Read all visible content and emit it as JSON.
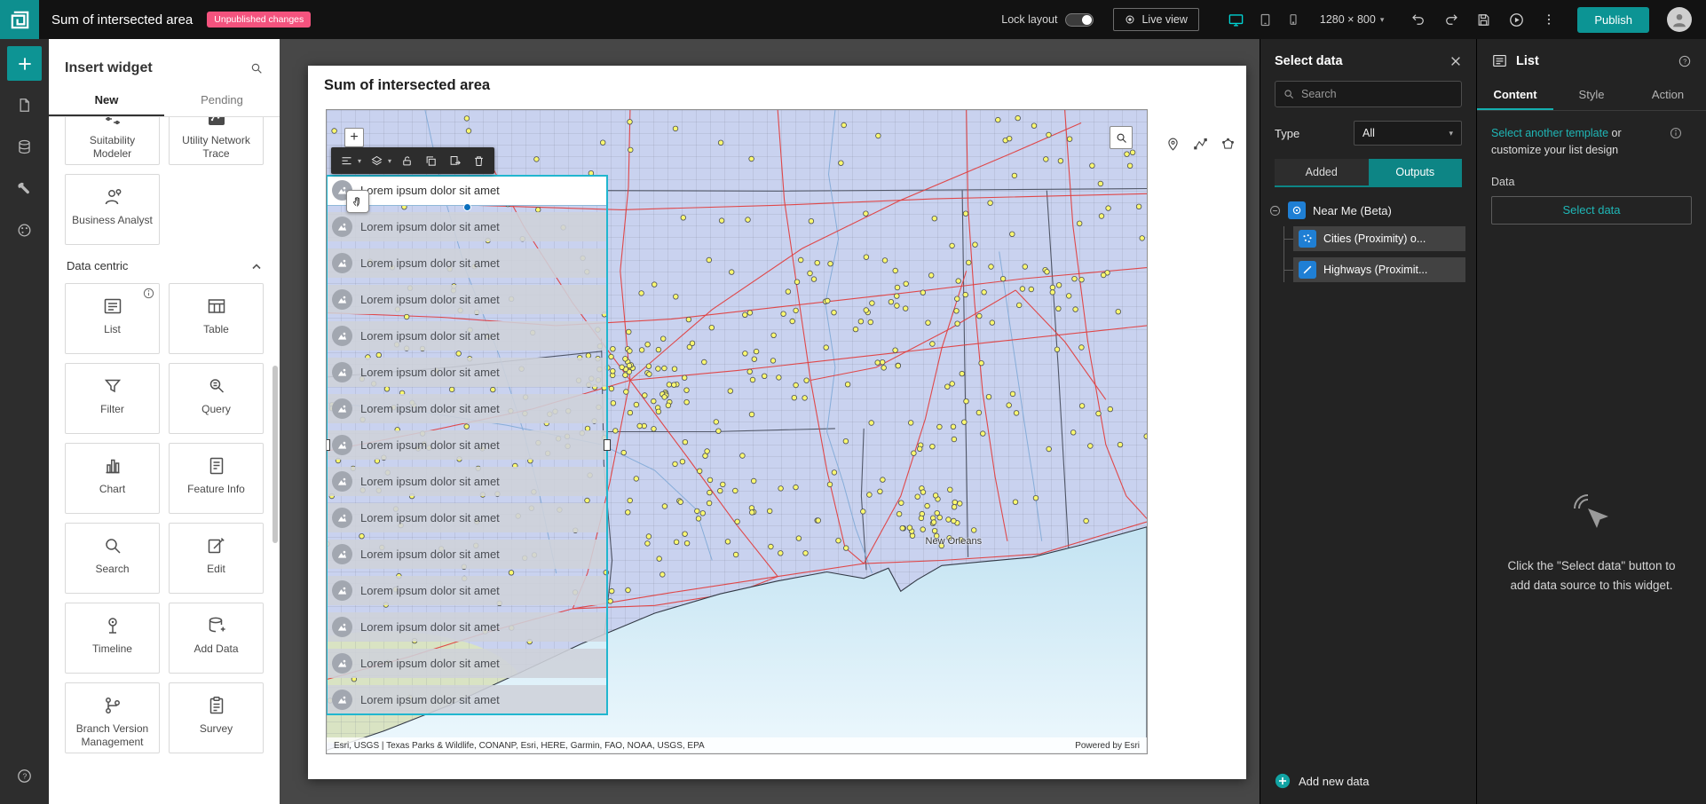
{
  "header": {
    "app_title": "Sum of intersected area",
    "badge": "Unpublished changes",
    "lock_layout_label": "Lock layout",
    "live_view_label": "Live view",
    "resolution": "1280 × 800",
    "publish_label": "Publish"
  },
  "insert_panel": {
    "title": "Insert widget",
    "tabs": [
      {
        "label": "New"
      },
      {
        "label": "Pending"
      }
    ],
    "top_cards": [
      {
        "label": "Suitability Modeler"
      },
      {
        "label": "Utility Network Trace"
      },
      {
        "label": "Business Analyst"
      }
    ],
    "section_label": "Data centric",
    "data_cards": [
      {
        "label": "List"
      },
      {
        "label": "Table"
      },
      {
        "label": "Filter"
      },
      {
        "label": "Query"
      },
      {
        "label": "Chart"
      },
      {
        "label": "Feature Info"
      },
      {
        "label": "Search"
      },
      {
        "label": "Edit"
      },
      {
        "label": "Timeline"
      },
      {
        "label": "Add Data"
      },
      {
        "label": "Branch Version Management"
      },
      {
        "label": "Survey"
      }
    ]
  },
  "canvas": {
    "artboard_title": "Sum of intersected area",
    "list_item_text": "Lorem ipsum dolor sit amet",
    "list_item_count": 15,
    "map_label_new_orleans": "New Orleans",
    "attribution": "Esri, USGS | Texas Parks & Wildlife, CONANP, Esri, HERE, Garmin, FAO, NOAA, USGS, EPA",
    "powered_by": "Powered by Esri"
  },
  "select_data_panel": {
    "title": "Select data",
    "search_placeholder": "Search",
    "type_label": "Type",
    "type_value": "All",
    "tabs": [
      {
        "label": "Added"
      },
      {
        "label": "Outputs"
      }
    ],
    "tree_root_label": "Near Me (Beta)",
    "tree_children": [
      {
        "label": "Cities (Proximity) o..."
      },
      {
        "label": "Highways (Proximit..."
      }
    ],
    "add_new_data_label": "Add new data"
  },
  "settings_panel": {
    "title": "List",
    "tabs": [
      {
        "label": "Content"
      },
      {
        "label": "Style"
      },
      {
        "label": "Action"
      }
    ],
    "template_link": "Select another template",
    "template_rest": "or customize your list design",
    "data_label": "Data",
    "select_data_button": "Select data",
    "hint_line1": "Click the \"Select data\" button to",
    "hint_line2": "add data source to this widget."
  },
  "colors": {
    "accent_teal": "#0c9494",
    "accent_bright": "#00d2d2",
    "badge_pink": "#f4537e",
    "selection_blue": "#0b6fbd",
    "map_land": "#c9d2ef",
    "map_water": "#cfe9f6",
    "road_red": "#e04040",
    "dot_yellow": "#f9f770"
  }
}
